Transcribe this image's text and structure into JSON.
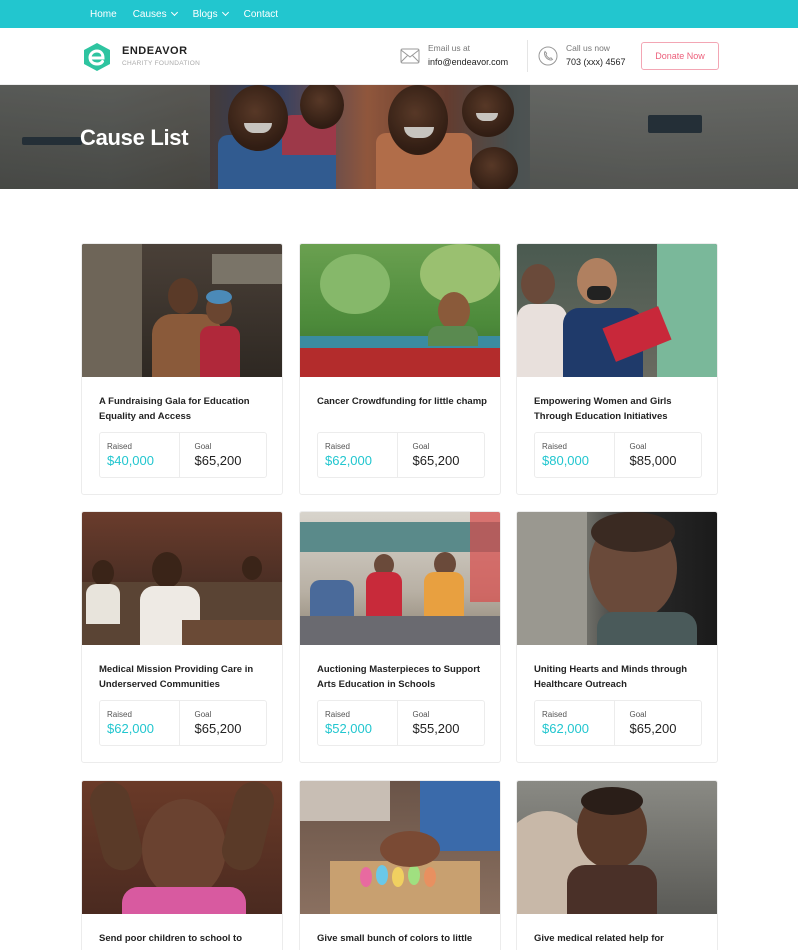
{
  "nav": {
    "items": [
      {
        "label": "Home",
        "dropdown": false
      },
      {
        "label": "Causes",
        "dropdown": true
      },
      {
        "label": "Blogs",
        "dropdown": true
      },
      {
        "label": "Contact",
        "dropdown": false
      }
    ]
  },
  "header": {
    "brand_name": "ENDEAVOR",
    "brand_sub": "CHARITY FOUNDATION",
    "email_label": "Email us at",
    "email_value": "info@endeavor.com",
    "phone_label": "Call us now",
    "phone_value": "703 (xxx) 4567",
    "donate_label": "Donate Now"
  },
  "hero": {
    "title": "Cause List"
  },
  "causes": [
    {
      "title": "A Fundraising Gala for Education Equality and Access",
      "raised_label": "Raised",
      "raised": "$40,000",
      "goal_label": "Goal",
      "goal": "$65,200"
    },
    {
      "title": "Cancer Crowdfunding for little champ",
      "raised_label": "Raised",
      "raised": "$62,000",
      "goal_label": "Goal",
      "goal": "$65,200"
    },
    {
      "title": "Empowering Women and Girls Through Education Initiatives",
      "raised_label": "Raised",
      "raised": "$80,000",
      "goal_label": "Goal",
      "goal": "$85,000"
    },
    {
      "title": "Medical Mission Providing Care in Underserved Communities",
      "raised_label": "Raised",
      "raised": "$62,000",
      "goal_label": "Goal",
      "goal": "$65,200"
    },
    {
      "title": "Auctioning Masterpieces to Support Arts Education in Schools",
      "raised_label": "Raised",
      "raised": "$52,000",
      "goal_label": "Goal",
      "goal": "$55,200"
    },
    {
      "title": "Uniting Hearts and Minds through Healthcare Outreach",
      "raised_label": "Raised",
      "raised": "$62,000",
      "goal_label": "Goal",
      "goal": "$65,200"
    },
    {
      "title": "Send poor children to school to",
      "raised_label": "",
      "raised": "",
      "goal_label": "",
      "goal": ""
    },
    {
      "title": "Give small bunch of colors to little",
      "raised_label": "",
      "raised": "",
      "goal_label": "",
      "goal": ""
    },
    {
      "title": "Give medical related help for",
      "raised_label": "",
      "raised": "",
      "goal_label": "",
      "goal": ""
    }
  ],
  "colors": {
    "accent": "#22c6cf",
    "donate_pink": "#ec5f7b",
    "logo_green": "#2ec4a0"
  },
  "icons": [
    "logo-e-icon",
    "chevron-down-icon",
    "mail-icon",
    "phone-icon"
  ]
}
